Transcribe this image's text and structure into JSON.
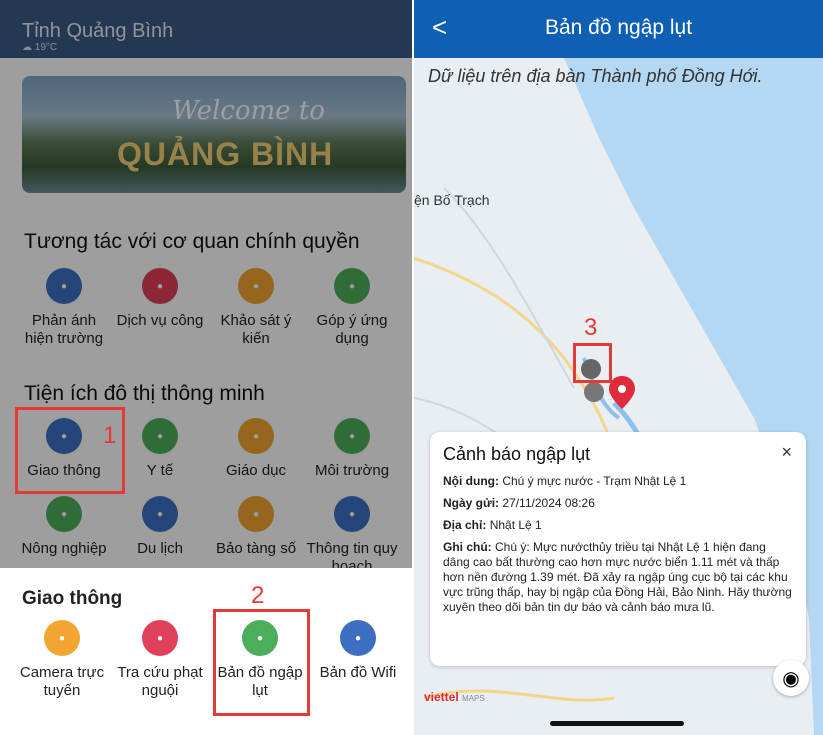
{
  "left": {
    "province": "Tỉnh Quảng Bình",
    "weather": "☁ 19°C",
    "banner": {
      "line1": "Welcome to",
      "line2": "QUẢNG BÌNH"
    },
    "section1": {
      "title": "Tương tác với cơ quan chính quyền",
      "items": [
        {
          "label": "Phản ánh hiện trường",
          "icon": "camera-report-icon",
          "color": "#3d6fc0"
        },
        {
          "label": "Dịch vụ công",
          "icon": "public-service-icon",
          "color": "#e0405a"
        },
        {
          "label": "Khảo sát ý kiến",
          "icon": "survey-icon",
          "color": "#f2a531"
        },
        {
          "label": "Góp ý ứng dụng",
          "icon": "feedback-icon",
          "color": "#4cae5a"
        }
      ]
    },
    "section2": {
      "title": "Tiện ích đô thị thông minh",
      "items": [
        {
          "label": "Giao thông",
          "icon": "traffic-icon",
          "color": "#3d6fc0"
        },
        {
          "label": "Y tế",
          "icon": "health-icon",
          "color": "#4cae5a"
        },
        {
          "label": "Giáo dục",
          "icon": "education-icon",
          "color": "#f2a531"
        },
        {
          "label": "Môi trường",
          "icon": "environment-icon",
          "color": "#4cae5a"
        },
        {
          "label": "Nông nghiệp",
          "icon": "agriculture-icon",
          "color": "#4cae5a"
        },
        {
          "label": "Du lịch",
          "icon": "tourism-icon",
          "color": "#3d6fc0"
        },
        {
          "label": "Bảo tàng số",
          "icon": "museum-icon",
          "color": "#f2a531"
        },
        {
          "label": "Thông tin quy hoạch",
          "icon": "planning-icon",
          "color": "#3d6fc0"
        }
      ]
    },
    "sheet": {
      "title": "Giao thông",
      "items": [
        {
          "label": "Camera trực tuyến",
          "icon": "cctv-camera-icon",
          "color": "#f2a531"
        },
        {
          "label": "Tra cứu phạt nguội",
          "icon": "car-fine-icon",
          "color": "#e0405a"
        },
        {
          "label": "Bản đồ ngập lụt",
          "icon": "flood-map-icon",
          "color": "#4cae5a"
        },
        {
          "label": "Bản đồ Wifi",
          "icon": "wifi-icon",
          "color": "#3d6fc0"
        }
      ]
    },
    "steps": [
      "1",
      "2",
      "3"
    ]
  },
  "right": {
    "title": "Bản đồ ngập lụt",
    "back": "<",
    "note": "Dữ liệu trên địa bàn Thành phố Đồng Hới.",
    "place": "ện Bố Trạch",
    "popup": {
      "title": "Cảnh báo ngập lụt",
      "close": "×",
      "content_label": "Nội dung:",
      "content": "Chú ý mực nước - Trạm Nhật Lệ 1",
      "date_label": "Ngày gửi:",
      "date": "27/11/2024 08:26",
      "address_label": "Địa chỉ:",
      "address": "Nhật Lệ 1",
      "note_label": "Ghi chú:",
      "note": "Chú ý: Mực nướcthủy triều  tại Nhật Lệ 1 hiện đang dâng cao bất thường cao hơn mực nước biển 1.11 mét và thấp hơn nền đường 1.39 mét. Đã xảy ra ngập úng cục bộ tại các khu vực trũng thấp, hay bị ngập của Đồng Hải, Bảo Ninh. Hãy thường xuyên theo dõi bản tin dự báo và cảnh báo mưa lũ."
    },
    "brand": "viettel",
    "brand_sub": "MAPS"
  }
}
